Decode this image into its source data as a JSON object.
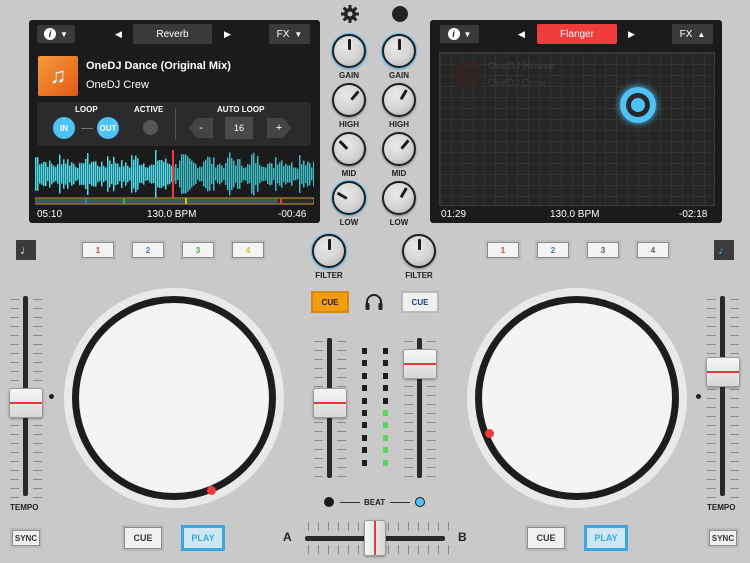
{
  "deck_a": {
    "info_label": "i",
    "fx_name": "Reverb",
    "fx_button": "FX",
    "track_title": "OneDJ Dance (Original Mix)",
    "track_artist": "OneDJ Crew",
    "loop_label": "LOOP",
    "loop_in": "IN",
    "loop_out": "OUT",
    "active_label": "ACTIVE",
    "auto_loop_label": "AUTO LOOP",
    "auto_loop_minus": "-",
    "auto_loop_value": "16",
    "auto_loop_plus": "+",
    "elapsed": "05:10",
    "bpm": "130.0 BPM",
    "remaining": "-00:46",
    "hotcues": [
      "1",
      "2",
      "3",
      "4"
    ],
    "hotcue_colors": [
      "#e23b3b",
      "#2f7fd1",
      "#3fae3f",
      "#e0b526"
    ],
    "tempo_label": "TEMPO",
    "sync_label": "SYNC",
    "cue_label": "CUE",
    "play_label": "PLAY",
    "tempo_position": 0.54
  },
  "deck_b": {
    "info_label": "i",
    "fx_name": "Flanger",
    "fx_button": "FX",
    "ghost_title": "OneDJ House",
    "ghost_artist": "OneDJ Crew",
    "elapsed": "01:29",
    "bpm": "130.0 BPM",
    "remaining": "-02:18",
    "hotcues": [
      "1",
      "2",
      "3",
      "4"
    ],
    "hotcue_colors": [
      "#e23b3b",
      "#2f7fd1",
      "#555555",
      "#555555"
    ],
    "tempo_label": "TEMPO",
    "sync_label": "SYNC",
    "cue_label": "CUE",
    "play_label": "PLAY",
    "tempo_position": 0.36
  },
  "mixer": {
    "gain_label": "GAIN",
    "high_label": "HIGH",
    "mid_label": "MID",
    "low_label": "LOW",
    "filter_label": "FILTER",
    "cue_a": "CUE",
    "cue_b": "CUE",
    "beat_label": "BEAT",
    "crossfader_a": "A",
    "crossfader_b": "B",
    "volume_a": 0.55,
    "volume_b": 0.9,
    "crossfader_position": 0.5
  },
  "colors": {
    "accent_blue": "#4fc3f7",
    "active_red": "#ef3b3b",
    "cue_orange": "#f39c12"
  },
  "icons": {
    "settings": "gear-icon",
    "record": "record-icon",
    "headphones": "headphones-icon",
    "music_note": "music-note-icon"
  }
}
